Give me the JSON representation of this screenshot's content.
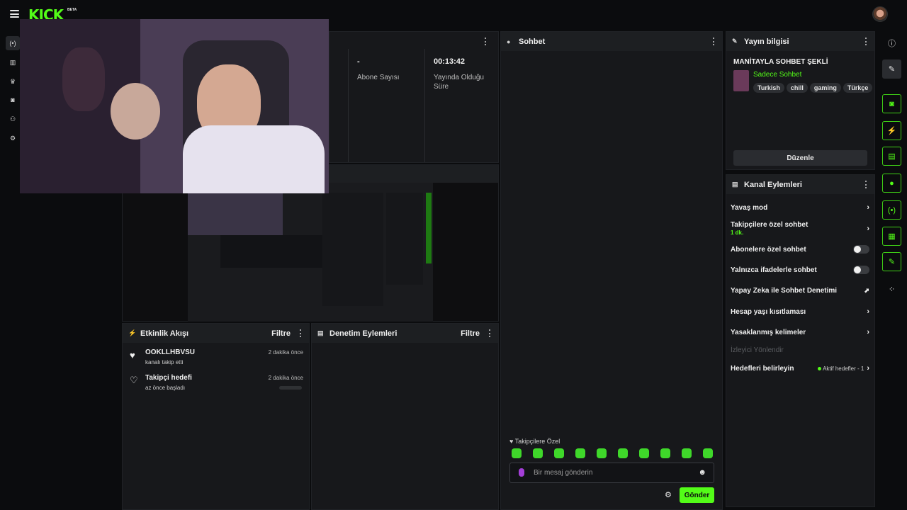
{
  "topbar": {
    "logo": "KICK",
    "beta": "BETA"
  },
  "stats": {
    "subscribers_value": "-",
    "subscribers_label": "Abone Sayısı",
    "uptime_value": "00:13:42",
    "uptime_label": "Yayında Olduğu Süre"
  },
  "chat": {
    "title": "Sohbet",
    "followers_only_label": "Takipçilere Özel",
    "input_placeholder": "Bir mesaj gönderin",
    "send_label": "Gönder"
  },
  "stream_info": {
    "title": "Yayın bilgisi",
    "stream_title": "MANİTAYLA SOHBET ŞEKLİ",
    "category": "Sadece Sohbet",
    "tags": [
      "Turkish",
      "chill",
      "gaming",
      "Türkçe"
    ],
    "edit_label": "Düzenle"
  },
  "channel_actions": {
    "title": "Kanal Eylemleri",
    "slow_mode": "Yavaş mod",
    "followers_chat": "Takipçilere özel sohbet",
    "followers_chat_value": "1 dk.",
    "subscribers_chat": "Abonelere özel sohbet",
    "emotes_chat": "Yalnızca ifadelerle sohbet",
    "ai_moderation": "Yapay Zeka ile Sohbet Denetimi",
    "age_restriction": "Hesap yaşı kısıtlaması",
    "banned_words": "Yasaklanmış kelimeler",
    "redirect": "İzleyici Yönlendir",
    "goals": "Hedefleri belirleyin",
    "goals_status": "Aktif hedefler - 1"
  },
  "activity": {
    "title": "Etkinlik Akışı",
    "filter_label": "Filtre",
    "items": [
      {
        "title": "OOKLLHBVSU",
        "subtitle": "kanalı takip etti",
        "time": "2 dakika önce"
      },
      {
        "title": "Takipçi hedefi",
        "subtitle": "az önce başladı",
        "time": "2 dakika önce"
      }
    ]
  },
  "moderation": {
    "title": "Denetim Eylemleri",
    "filter_label": "Filtre"
  },
  "colors": {
    "accent": "#53fc18",
    "panel": "#17181b",
    "background": "#0b0c0e"
  }
}
